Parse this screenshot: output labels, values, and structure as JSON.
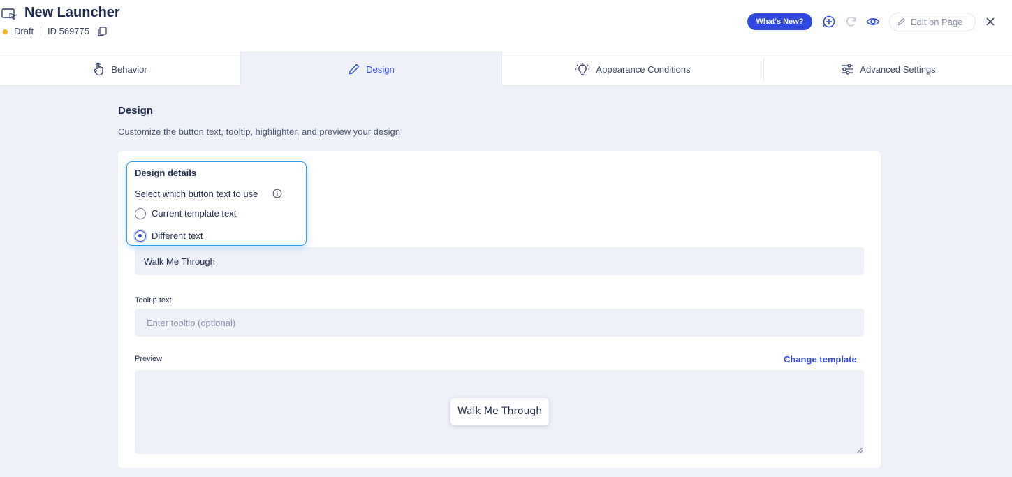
{
  "header": {
    "title": "New Launcher",
    "status": "Draft",
    "id_label": "ID 569775",
    "whats_new": "What's New?",
    "edit_on_page": "Edit on Page",
    "colors": {
      "accent": "#2f49e0",
      "draft_dot": "#f5b51c"
    },
    "icons": [
      "launcher-icon",
      "copy-icon",
      "add-circle-icon",
      "refresh-icon",
      "eye-icon",
      "pencil-icon",
      "close-icon"
    ]
  },
  "tabs": [
    {
      "label": "Behavior",
      "icon": "hand-pointer-icon",
      "active": false
    },
    {
      "label": "Design",
      "icon": "pencil-icon",
      "active": true
    },
    {
      "label": "Appearance Conditions",
      "icon": "lightbulb-icon",
      "active": false
    },
    {
      "label": "Advanced Settings",
      "icon": "sliders-icon",
      "active": false
    }
  ],
  "content": {
    "title": "Design",
    "subtitle": "Customize the button text, tooltip, highlighter, and preview your design"
  },
  "design_details": {
    "title": "Design details",
    "question": "Select which button text to use",
    "options": [
      {
        "label": "Current template text",
        "selected": false
      },
      {
        "label": "Different text",
        "selected": true
      }
    ],
    "button_text_value": "Walk Me Through"
  },
  "tooltip": {
    "label": "Tooltip text",
    "placeholder": "Enter tooltip (optional)"
  },
  "preview": {
    "label": "Preview",
    "change_template": "Change template",
    "button_text": "Walk Me Through"
  }
}
